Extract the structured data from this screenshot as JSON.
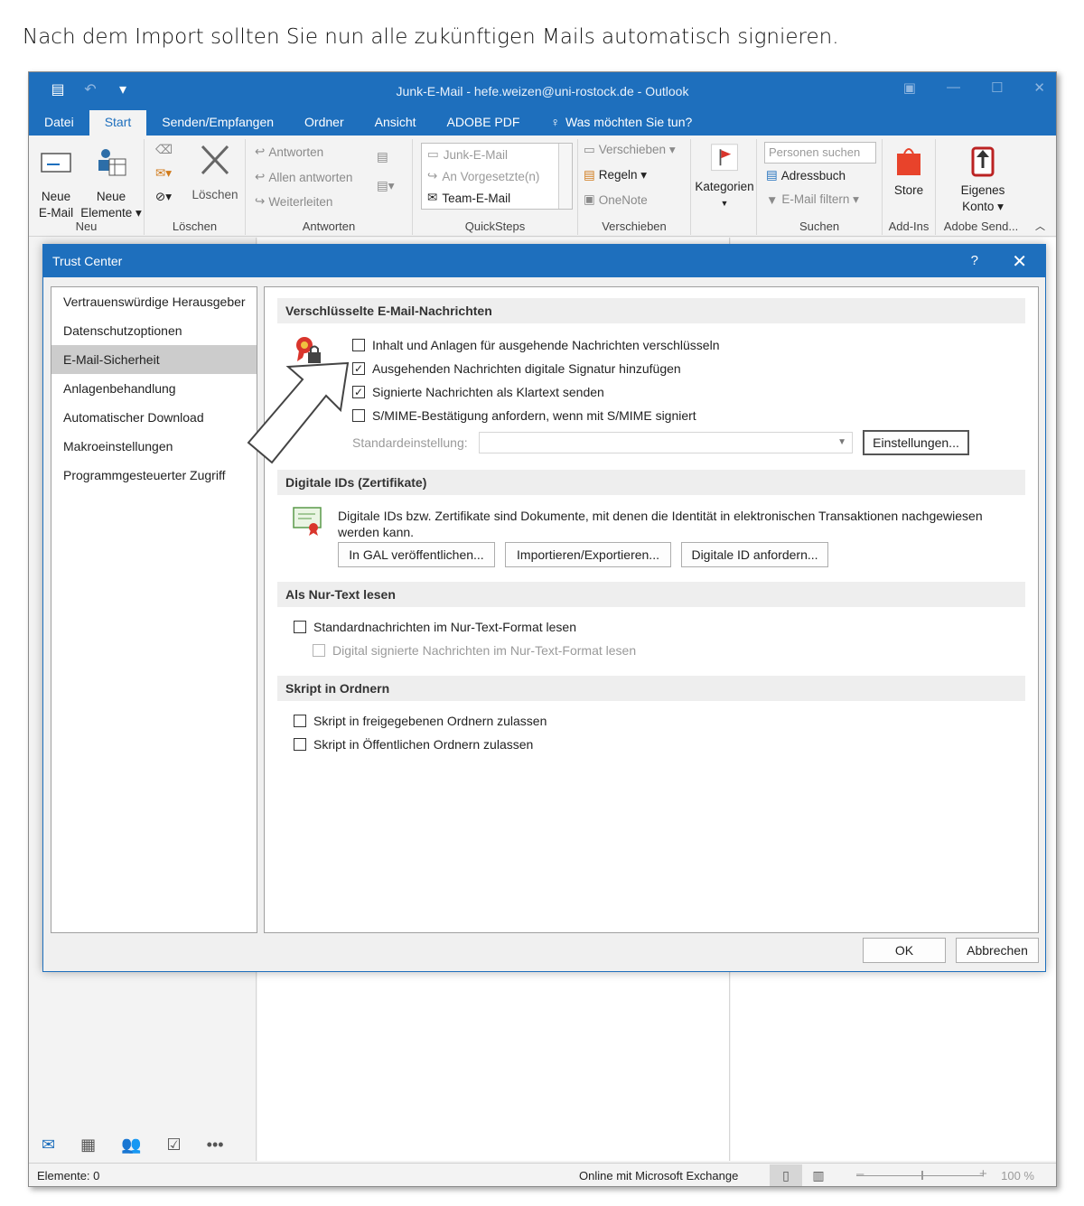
{
  "intro_text": "Nach dem Import sollten Sie nun alle zukünftigen Mails automatisch signieren.",
  "window": {
    "title": "Junk-E-Mail - hefe.weizen@uni-rostock.de - Outlook"
  },
  "tabs": [
    "Datei",
    "Start",
    "Senden/Empfangen",
    "Ordner",
    "Ansicht",
    "ADOBE PDF",
    "Was möchten Sie tun?"
  ],
  "ribbon": {
    "neu": {
      "label": "Neu",
      "new_email_1": "Neue",
      "new_email_2": "E-Mail",
      "new_items_1": "Neue",
      "new_items_2": "Elemente ▾"
    },
    "loeschen": {
      "label": "Löschen",
      "delete": "Löschen"
    },
    "antworten": {
      "label": "Antworten",
      "reply": "Antworten",
      "reply_all": "Allen antworten",
      "forward": "Weiterleiten"
    },
    "quicksteps": {
      "label": "QuickSteps",
      "items": [
        "Junk-E-Mail",
        "An Vorgesetzte(n)",
        "Team-E-Mail"
      ]
    },
    "verschieben": {
      "label": "Verschieben",
      "move": "Verschieben ▾",
      "rules": "Regeln ▾",
      "onenote": "OneNote"
    },
    "kategorien": {
      "label": "Kategorien"
    },
    "suchen": {
      "label": "Suchen",
      "search_placeholder": "Personen suchen",
      "addressbook": "Adressbuch",
      "filter": "E-Mail filtern ▾"
    },
    "addins": {
      "label": "Add-Ins",
      "store": "Store"
    },
    "adobe": {
      "label": "Adobe Send...",
      "account_1": "Eigenes",
      "account_2": "Konto ▾"
    }
  },
  "statusbar": {
    "items": "Elemente: 0",
    "connection": "Online mit Microsoft Exchange",
    "zoom": "100 %"
  },
  "dialog": {
    "title": "Trust Center",
    "help": "?",
    "categories": [
      "Vertrauenswürdige Herausgeber",
      "Datenschutzoptionen",
      "E-Mail-Sicherheit",
      "Anlagenbehandlung",
      "Automatischer Download",
      "Makroeinstellungen",
      "Programmgesteuerter Zugriff"
    ],
    "selected_category": "E-Mail-Sicherheit",
    "sections": {
      "encrypted": {
        "header": "Verschlüsselte E-Mail-Nachrichten",
        "options": [
          {
            "label": "Inhalt und Anlagen für ausgehende Nachrichten verschlüsseln",
            "checked": false
          },
          {
            "label": "Ausgehenden Nachrichten digitale Signatur hinzufügen",
            "checked": true
          },
          {
            "label": "Signierte Nachrichten als Klartext senden",
            "checked": true
          },
          {
            "label": "S/MIME-Bestätigung anfordern, wenn mit S/MIME signiert",
            "checked": false
          }
        ],
        "default_setting_label": "Standardeinstellung:",
        "settings_button": "Einstellungen..."
      },
      "digital_ids": {
        "header": "Digitale IDs (Zertifikate)",
        "description": "Digitale IDs bzw. Zertifikate sind Dokumente, mit denen die Identität in elektronischen Transaktionen nachgewiesen werden kann.",
        "buttons": [
          "In GAL veröffentlichen...",
          "Importieren/Exportieren...",
          "Digitale ID anfordern..."
        ]
      },
      "plain_text": {
        "header": "Als Nur-Text lesen",
        "options": [
          {
            "label": "Standardnachrichten im Nur-Text-Format lesen",
            "checked": false
          },
          {
            "label": "Digital signierte Nachrichten im Nur-Text-Format lesen",
            "checked": false
          }
        ]
      },
      "script": {
        "header": "Skript in Ordnern",
        "options": [
          {
            "label": "Skript in freigegebenen Ordnern zulassen",
            "checked": false
          },
          {
            "label": "Skript in Öffentlichen Ordnern zulassen",
            "checked": false
          }
        ]
      }
    },
    "ok": "OK",
    "cancel": "Abbrechen"
  },
  "colors": {
    "accent": "#1e6fbd",
    "ribbon_bg": "#f3f3f3",
    "selected_category": "#cccccc"
  }
}
